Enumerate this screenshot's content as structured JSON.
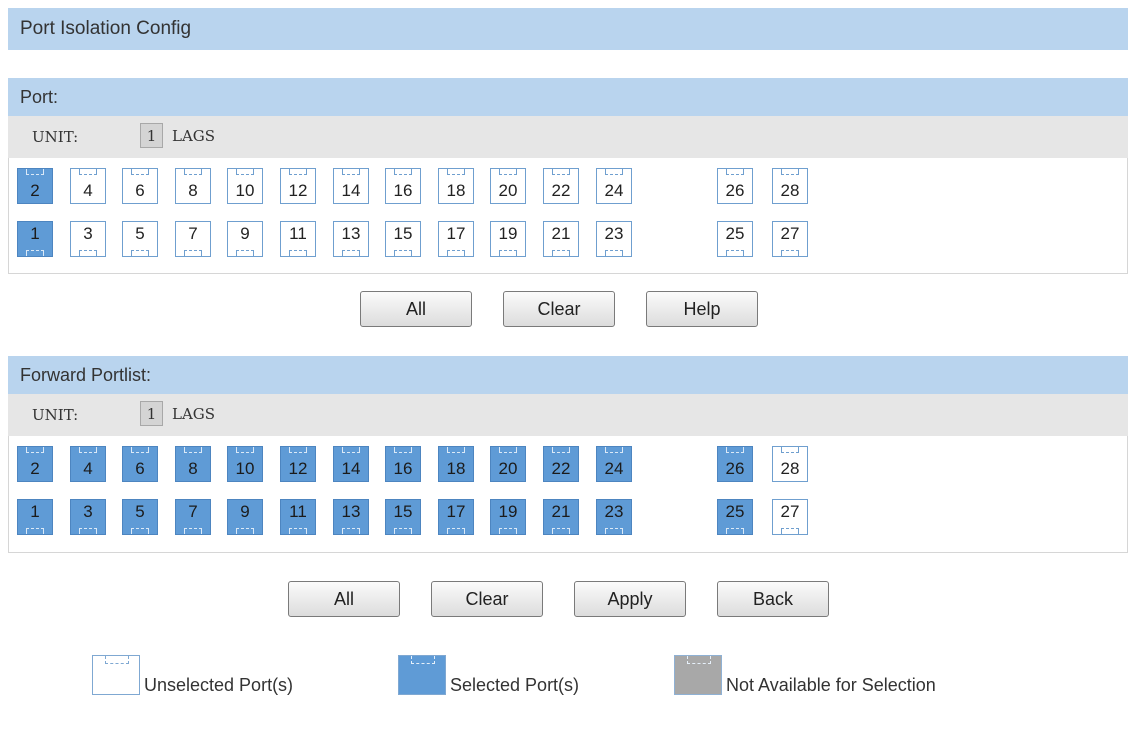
{
  "page": {
    "title": "Port Isolation Config"
  },
  "port_section": {
    "header": "Port:",
    "unit_label": "UNIT:",
    "unit_value": "1",
    "lags_label": "LAGS",
    "top_row": [
      {
        "label": "2",
        "state": "selected"
      },
      {
        "label": "4",
        "state": "unselected"
      },
      {
        "label": "6",
        "state": "unselected"
      },
      {
        "label": "8",
        "state": "unselected"
      },
      {
        "label": "10",
        "state": "unselected"
      },
      {
        "label": "12",
        "state": "unselected"
      },
      {
        "label": "14",
        "state": "unselected"
      },
      {
        "label": "16",
        "state": "unselected"
      },
      {
        "label": "18",
        "state": "unselected"
      },
      {
        "label": "20",
        "state": "unselected"
      },
      {
        "label": "22",
        "state": "unselected"
      },
      {
        "label": "24",
        "state": "unselected"
      },
      {
        "label": "26",
        "state": "unselected"
      },
      {
        "label": "28",
        "state": "unselected"
      }
    ],
    "bottom_row": [
      {
        "label": "1",
        "state": "selected"
      },
      {
        "label": "3",
        "state": "unselected"
      },
      {
        "label": "5",
        "state": "unselected"
      },
      {
        "label": "7",
        "state": "unselected"
      },
      {
        "label": "9",
        "state": "unselected"
      },
      {
        "label": "11",
        "state": "unselected"
      },
      {
        "label": "13",
        "state": "unselected"
      },
      {
        "label": "15",
        "state": "unselected"
      },
      {
        "label": "17",
        "state": "unselected"
      },
      {
        "label": "19",
        "state": "unselected"
      },
      {
        "label": "21",
        "state": "unselected"
      },
      {
        "label": "23",
        "state": "unselected"
      },
      {
        "label": "25",
        "state": "unselected"
      },
      {
        "label": "27",
        "state": "unselected"
      }
    ],
    "buttons": {
      "all": "All",
      "clear": "Clear",
      "help": "Help"
    }
  },
  "forward_section": {
    "header": "Forward Portlist:",
    "unit_label": "UNIT:",
    "unit_value": "1",
    "lags_label": "LAGS",
    "top_row": [
      {
        "label": "2",
        "state": "selected"
      },
      {
        "label": "4",
        "state": "selected"
      },
      {
        "label": "6",
        "state": "selected"
      },
      {
        "label": "8",
        "state": "selected"
      },
      {
        "label": "10",
        "state": "selected"
      },
      {
        "label": "12",
        "state": "selected"
      },
      {
        "label": "14",
        "state": "selected"
      },
      {
        "label": "16",
        "state": "selected"
      },
      {
        "label": "18",
        "state": "selected"
      },
      {
        "label": "20",
        "state": "selected"
      },
      {
        "label": "22",
        "state": "selected"
      },
      {
        "label": "24",
        "state": "selected"
      },
      {
        "label": "26",
        "state": "selected"
      },
      {
        "label": "28",
        "state": "unselected"
      }
    ],
    "bottom_row": [
      {
        "label": "1",
        "state": "selected"
      },
      {
        "label": "3",
        "state": "selected"
      },
      {
        "label": "5",
        "state": "selected"
      },
      {
        "label": "7",
        "state": "selected"
      },
      {
        "label": "9",
        "state": "selected"
      },
      {
        "label": "11",
        "state": "selected"
      },
      {
        "label": "13",
        "state": "selected"
      },
      {
        "label": "15",
        "state": "selected"
      },
      {
        "label": "17",
        "state": "selected"
      },
      {
        "label": "19",
        "state": "selected"
      },
      {
        "label": "21",
        "state": "selected"
      },
      {
        "label": "23",
        "state": "selected"
      },
      {
        "label": "25",
        "state": "selected"
      },
      {
        "label": "27",
        "state": "unselected"
      }
    ],
    "buttons": {
      "all": "All",
      "clear": "Clear",
      "apply": "Apply",
      "back": "Back"
    }
  },
  "legend": {
    "unselected": "Unselected Port(s)",
    "selected": "Selected Port(s)",
    "not_available": "Not Available for Selection"
  },
  "colors": {
    "header_bg": "#b9d4ee",
    "unit_row_bg": "#e6e6e6",
    "port_selected": "#5f9bd6",
    "port_border": "#6f9fcf",
    "port_not_available": "#a8a8a8"
  }
}
